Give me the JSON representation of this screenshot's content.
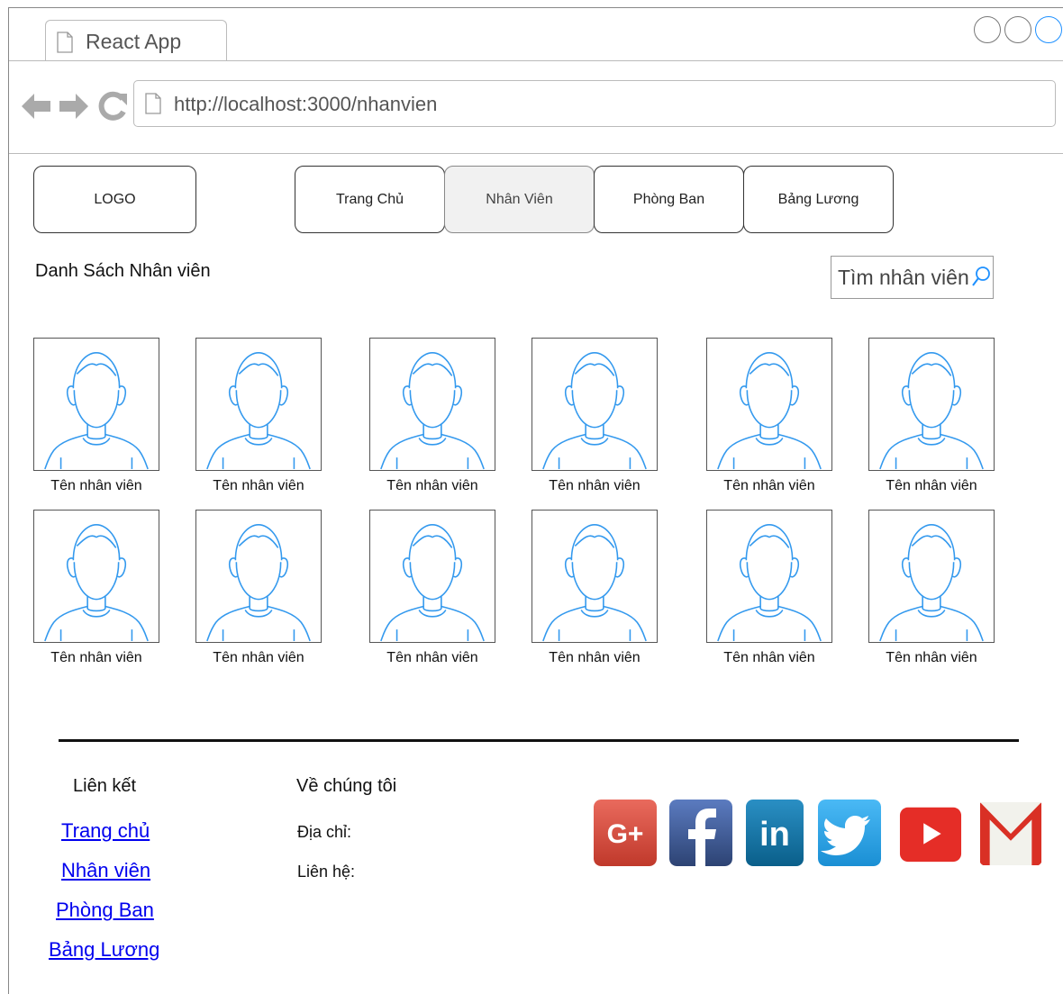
{
  "browser": {
    "tab_title": "React App",
    "url": "http://localhost:3000/nhanvien"
  },
  "nav": {
    "logo": "LOGO",
    "items": [
      {
        "label": "Trang Chủ",
        "active": false
      },
      {
        "label": "Nhân Viên",
        "active": true
      },
      {
        "label": "Phòng Ban",
        "active": false
      },
      {
        "label": "Bảng Lương",
        "active": false
      }
    ]
  },
  "main": {
    "heading": "Danh Sách Nhân viên",
    "search_placeholder": "Tìm nhân viên",
    "employees": [
      {
        "name": "Tên nhân viên"
      },
      {
        "name": "Tên nhân viên"
      },
      {
        "name": "Tên nhân viên"
      },
      {
        "name": "Tên nhân viên"
      },
      {
        "name": "Tên nhân viên"
      },
      {
        "name": "Tên nhân viên"
      },
      {
        "name": "Tên nhân viên"
      },
      {
        "name": "Tên nhân viên"
      },
      {
        "name": "Tên nhân viên"
      },
      {
        "name": "Tên nhân viên"
      },
      {
        "name": "Tên nhân viên"
      },
      {
        "name": "Tên nhân viên"
      }
    ]
  },
  "footer": {
    "links_heading": "Liên kết",
    "links": [
      "Trang chủ",
      "Nhân viên",
      "Phòng Ban",
      "Bảng Lương"
    ],
    "about_heading": "Về chúng tôi",
    "address_label": "Địa chỉ:",
    "contact_label": "Liên hệ:",
    "social": [
      "google-plus",
      "facebook",
      "linkedin",
      "twitter",
      "youtube",
      "gmail"
    ]
  },
  "colors": {
    "avatar_line": "#3399ee",
    "link": "#0000ee",
    "google_plus": "#d6493a",
    "facebook": "#3b5998",
    "linkedin": "#0e76a8",
    "twitter": "#1da1f2",
    "youtube": "#e52d27",
    "gmail": "#d93025"
  }
}
